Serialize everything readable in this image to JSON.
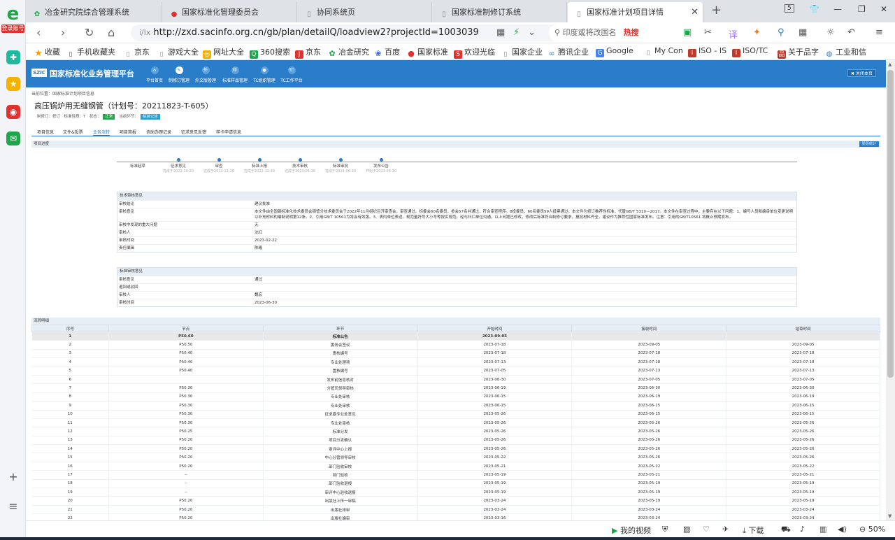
{
  "rail": {
    "logo_label": "登录账号"
  },
  "tabs": [
    {
      "label": "冶金研究院综合管理系统"
    },
    {
      "label": "国家标准化管理委员会"
    },
    {
      "label": "协同系统页"
    },
    {
      "label": "国家标准制修订系统"
    },
    {
      "label": "国家标准计划项目详情"
    }
  ],
  "tab_count": "5",
  "url": "http://zxd.sacinfo.org.cn/gb/plan/detailQ/loadview2?projectId=1003039",
  "url_prefix_icon": "i/lx",
  "search_placeholder": "印度或将改国名",
  "search_hot": "热搜",
  "bookmarks": [
    {
      "label": "收藏"
    },
    {
      "label": "手机收藏夹"
    },
    {
      "label": "京东"
    },
    {
      "label": "游戏大全"
    },
    {
      "label": "网址大全"
    },
    {
      "label": "360搜索"
    },
    {
      "label": "京东"
    },
    {
      "label": "冶金研究"
    },
    {
      "label": "百度"
    },
    {
      "label": "国家标准"
    },
    {
      "label": "欢迎光临"
    },
    {
      "label": "国家企业"
    },
    {
      "label": "腾讯企业"
    },
    {
      "label": "Google"
    },
    {
      "label": "My Con"
    },
    {
      "label": "ISO - IS"
    },
    {
      "label": "ISO/TC"
    },
    {
      "label": "关于品字"
    },
    {
      "label": "工业和信"
    }
  ],
  "header": {
    "title": "国家标准化业务管理平台",
    "logo": "SZIC",
    "nav": [
      {
        "label": "平台首页"
      },
      {
        "label": "制修订管理"
      },
      {
        "label": "外文版管理"
      },
      {
        "label": "标准样品管理"
      },
      {
        "label": "TC组织管理"
      },
      {
        "label": "TC工作平台"
      }
    ],
    "close": "关闭本页"
  },
  "crumb": "当前位置：国家标准计划项目信息",
  "project": {
    "title": "高压锅炉用无缝钢管（计划号：20211823-T-605）",
    "meta": "制修订：修订　标准性质：T　状态：",
    "status_tag": "正常",
    "stage_label": "当前环节：",
    "stage_tag": "标准公告"
  },
  "subtabs": [
    {
      "label": "项目信息"
    },
    {
      "label": "文件&投票"
    },
    {
      "label": "业务流转"
    },
    {
      "label": "项目简报"
    },
    {
      "label": "协助办理记录"
    },
    {
      "label": "征求意见反馈"
    },
    {
      "label": "样卡申请信息"
    }
  ],
  "progress": {
    "section": "项目进度",
    "button": "阶段统计",
    "steps": [
      {
        "name": "标准起草",
        "sub": ""
      },
      {
        "name": "征求意见",
        "sub": "完成于2022-10-20"
      },
      {
        "name": "审查",
        "sub": "完成于2022-12-28"
      },
      {
        "name": "标准上报",
        "sub": "完成于2022-12-30"
      },
      {
        "name": "技术审核",
        "sub": "完成于2023-05-26"
      },
      {
        "name": "标准审批",
        "sub": "完成于2023-06-30"
      },
      {
        "name": "发布公告",
        "sub": "开始于2023-06-30"
      }
    ]
  },
  "tech_review": {
    "title": "技术审核意见",
    "rows": [
      {
        "k": "审核结论",
        "v": "建议批准"
      },
      {
        "k": "审核意见",
        "v": "本文件由全国钢标准化技术委员会钢管分技术委员会于2022年11月组织召开审查会，审查通过。标委会60名委员，参会57名并通过，符合审查程序。8投委员，60名委员59人投票通过。本文件为修订推荐性标准，代替GB/T 5310—2017。本文件在审查过程中，主要存在以下问题：1、编写人员和编审单位变更说明以补充材料的编制说明第12条。2、引用GB/T 10561为将会有效版。3、表内单位表述、规范量符号大小写等按实规范。经与归口单位沟通，以上问题已修改，修改后标准符合制修订要求，报批材料齐全，建议作为推荐性国家标准发布。注意：引用的GB/T10561 将概止预期发布。"
      },
      {
        "k": "审核中发现的重大问题",
        "v": "无"
      },
      {
        "k": "审核人",
        "v": "沈红"
      },
      {
        "k": "审核时间",
        "v": "2023-02-22"
      },
      {
        "k": "责任编辑",
        "v": "陈曦"
      }
    ]
  },
  "std_review": {
    "title": "标准审核意见",
    "rows": [
      {
        "k": "审核意见",
        "v": "通过"
      },
      {
        "k": "退回或驳回",
        "v": ""
      },
      {
        "k": "审核人",
        "v": "魏宏"
      },
      {
        "k": "审核时间",
        "v": "2023-06-30"
      }
    ]
  },
  "flow": {
    "section": "流转明细",
    "columns": [
      "序号",
      "节点",
      "环节",
      "开始时间",
      "接收时间",
      "结束时间"
    ],
    "rows": [
      [
        "1",
        "P50.60",
        "标准公告",
        "2023-09-05",
        "",
        ""
      ],
      [
        "2",
        "P50.50",
        "委务会签议",
        "2023-07-18",
        "2023-09-05",
        "2023-09-05"
      ],
      [
        "3",
        "P50.40",
        "寄核编号",
        "2023-07-18",
        "2023-07-18",
        "2023-07-18"
      ],
      [
        "4",
        "P50.40",
        "专业处理项",
        "2023-07-13",
        "2023-07-18",
        "2023-07-18"
      ],
      [
        "5",
        "P50.40",
        "置核编号",
        "2023-07-05",
        "2023-07-13",
        "2023-07-13"
      ],
      [
        "6",
        "",
        "发布前信息核对",
        "2023-06-30",
        "2023-07-05",
        "2023-07-05"
      ],
      [
        "7",
        "P50.30",
        "分管司领导审核",
        "2023-06-19",
        "2023-06-30",
        "2023-06-30"
      ],
      [
        "8",
        "P50.30",
        "专业处审核",
        "2023-06-15",
        "2023-06-19",
        "2023-06-19"
      ],
      [
        "9",
        "P50.30",
        "专业处审核",
        "2023-06-15",
        "2023-06-15",
        "2023-06-15"
      ],
      [
        "10",
        "P50.30",
        "征求委专业处意见",
        "2023-05-26",
        "2023-06-15",
        "2023-06-15"
      ],
      [
        "11",
        "P50.30",
        "专业处审核",
        "2023-05-26",
        "2023-05-26",
        "2023-05-26"
      ],
      [
        "12",
        "P50.25",
        "标准分发",
        "2023-05-26",
        "2023-05-26",
        "2023-05-26"
      ],
      [
        "13",
        "P50.20",
        "项目分发确认",
        "2023-05-26",
        "2023-05-26",
        "2023-05-26"
      ],
      [
        "14",
        "P50.20",
        "审评中心上报",
        "2023-05-26",
        "2023-05-26",
        "2023-05-26"
      ],
      [
        "15",
        "P50.20",
        "中心分管领导审核",
        "2023-05-22",
        "2023-05-26",
        "2023-05-26"
      ],
      [
        "16",
        "P50.20",
        "部门验收审核",
        "2023-05-21",
        "2023-05-22",
        "2023-05-22"
      ],
      [
        "17",
        "--",
        "部门验收",
        "2023-05-19",
        "2023-05-21",
        "2023-05-21"
      ],
      [
        "18",
        "--",
        "部门验收退报",
        "2023-05-19",
        "2023-05-19",
        "2023-05-19"
      ],
      [
        "19",
        "--",
        "审评中心验收退报",
        "2023-05-19",
        "2023-05-19",
        "2023-05-19"
      ],
      [
        "20",
        "P50.20",
        "出版社上传一审稿",
        "2023-03-24",
        "2023-05-19",
        "2023-05-19"
      ],
      [
        "21",
        "P50.20",
        "出版社排审",
        "2023-03-24",
        "2023-03-24",
        "2023-03-24"
      ],
      [
        "22",
        "P50.20",
        "出版社编审",
        "2023-03-16",
        "2023-03-24",
        "2023-03-24"
      ]
    ]
  },
  "status_bar": {
    "video": "我的视频",
    "download": "下载",
    "zoom": "50%"
  },
  "colors": {
    "header": "#2a7dc8",
    "accent": "#2a7dc8",
    "status_tag": "#1fa64a",
    "stage_tag": "#2a9fd6"
  }
}
